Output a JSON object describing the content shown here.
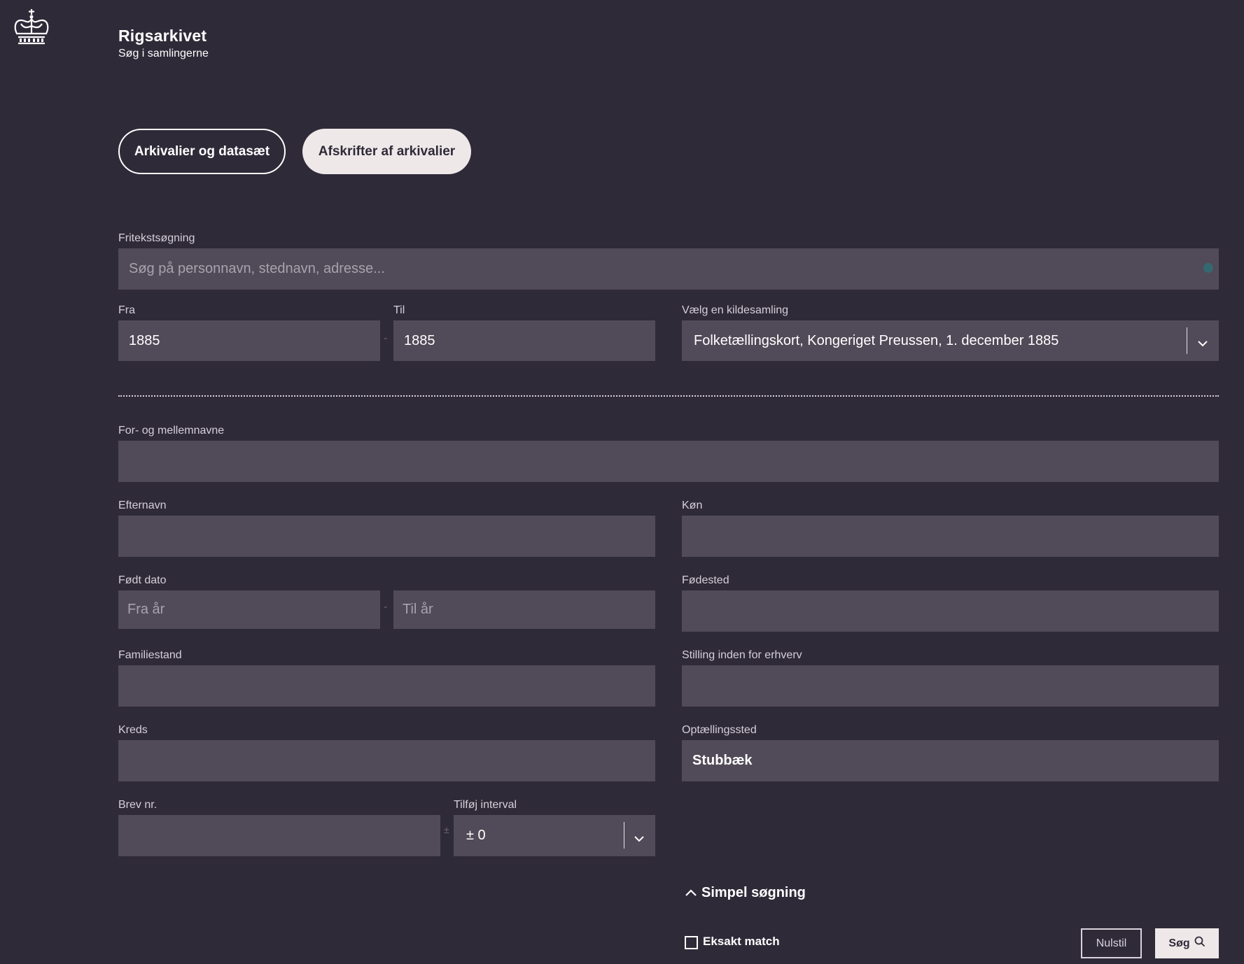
{
  "header": {
    "title": "Rigsarkivet",
    "subtitle": "Søg i samlingerne"
  },
  "tabs": [
    {
      "label": "Arkivalier og datasæt"
    },
    {
      "label": "Afskrifter af arkivalier"
    }
  ],
  "freetext": {
    "label": "Fritekstsøgning",
    "placeholder": "Søg på personnavn, stednavn, adresse..."
  },
  "period": {
    "from_label": "Fra",
    "from_value": "1885",
    "to_label": "Til",
    "to_value": "1885",
    "separator": "-"
  },
  "collection": {
    "label": "Vælg en kildesamling",
    "value": "Folketællingskort, Kongeriget Preussen, 1. december 1885"
  },
  "fields": {
    "firstnames": {
      "label": "For- og mellemnavne",
      "value": ""
    },
    "surname": {
      "label": "Efternavn",
      "value": ""
    },
    "gender": {
      "label": "Køn",
      "value": ""
    },
    "born": {
      "label": "Født dato",
      "from_placeholder": "Fra år",
      "to_placeholder": "Til år",
      "separator": "-"
    },
    "birthplace": {
      "label": "Fødested",
      "value": ""
    },
    "marital": {
      "label": "Familiestand",
      "value": ""
    },
    "occupation": {
      "label": "Stilling inden for erhverv",
      "value": ""
    },
    "district": {
      "label": "Kreds",
      "value": ""
    },
    "census_place": {
      "label": "Optællingssted",
      "value": "Stubbæk"
    },
    "letter_no": {
      "label": "Brev nr.",
      "value": ""
    },
    "interval": {
      "label": "Tilføj interval",
      "value": "± 0",
      "pm_symbol": "±"
    }
  },
  "controls": {
    "simple_search": "Simpel søgning",
    "exact_match": "Eksakt match",
    "reset": "Nulstil",
    "search": "Søg"
  },
  "colors": {
    "background": "#2f2a38",
    "field": "#514a58",
    "light_button": "#efe8e9"
  }
}
